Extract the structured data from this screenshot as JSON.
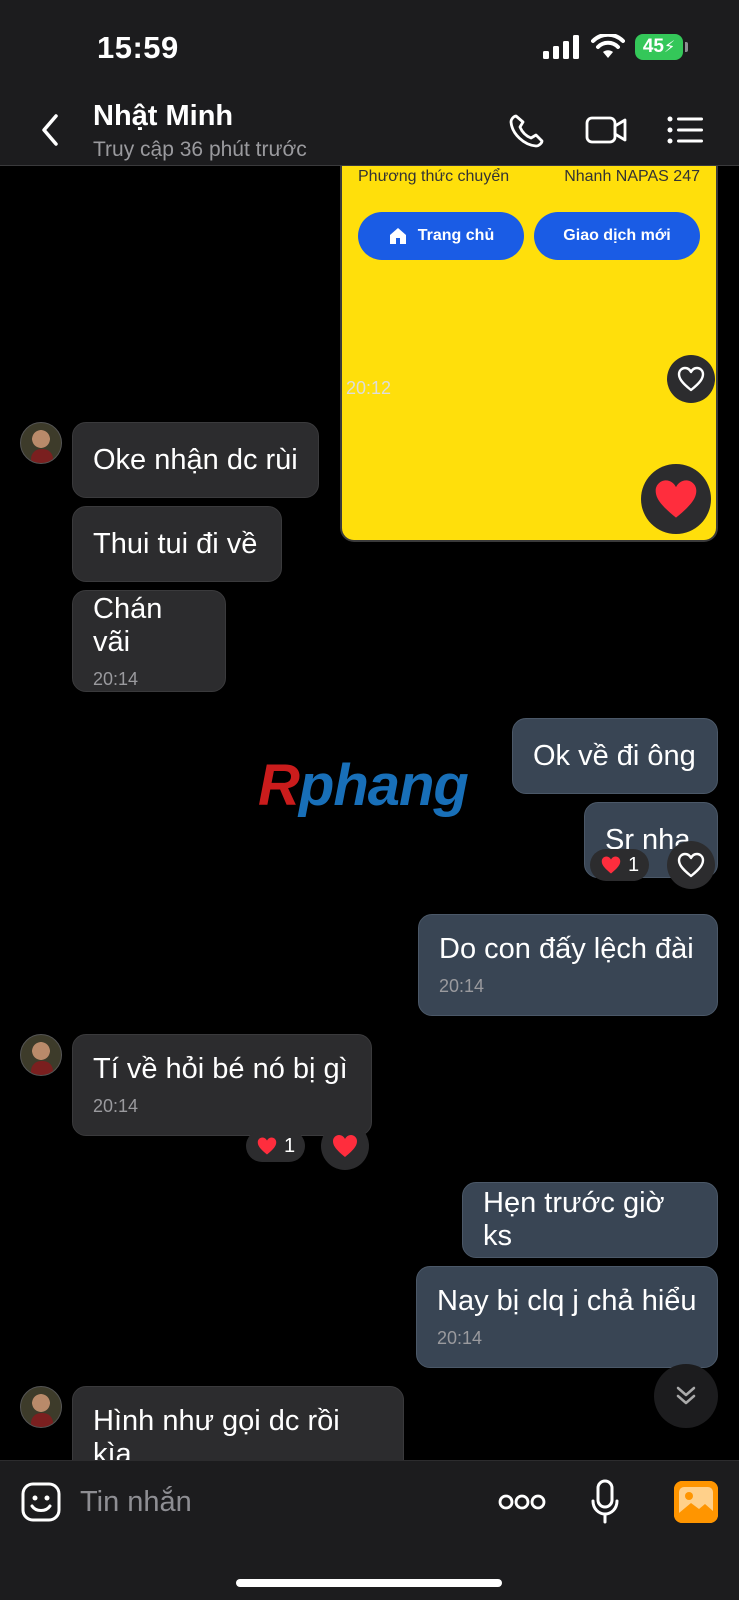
{
  "status_bar": {
    "time": "15:59",
    "battery": "45"
  },
  "header": {
    "name": "Nhật Minh",
    "status": "Truy cập 36 phút trước"
  },
  "receipt": {
    "label": "Phương thức chuyển",
    "value": "Nhanh NAPAS 247",
    "btn_home": "Trang chủ",
    "btn_new": "Giao dịch mới",
    "time": "20:12"
  },
  "messages": [
    {
      "text": "Oke nhận dc rùi"
    },
    {
      "text": "Thui tui đi về"
    },
    {
      "text": "Chán vãi",
      "time": "20:14"
    },
    {
      "text": "Ok về đi ông"
    },
    {
      "text": "Sr nha",
      "reaction_count": "1"
    },
    {
      "text": "Do con đấy lệch đài",
      "time": "20:14"
    },
    {
      "text": "Tí về hỏi bé nó bị gì",
      "time": "20:14",
      "reaction_count": "1"
    },
    {
      "text": "Hẹn trước giờ ks"
    },
    {
      "text": "Nay bị clq j chả hiểu",
      "time": "20:14"
    },
    {
      "text": "Hình như gọi dc rồi kìa"
    }
  ],
  "watermark": {
    "r": "R",
    "rest": "phang"
  },
  "composer": {
    "placeholder": "Tin nhắn"
  },
  "colors": {
    "accent": "#1a5ce5",
    "receipt_bg": "#ffdf0b",
    "outgoing": "#394554",
    "incoming": "#2c2c2e",
    "heart": "#ff2d3d"
  }
}
